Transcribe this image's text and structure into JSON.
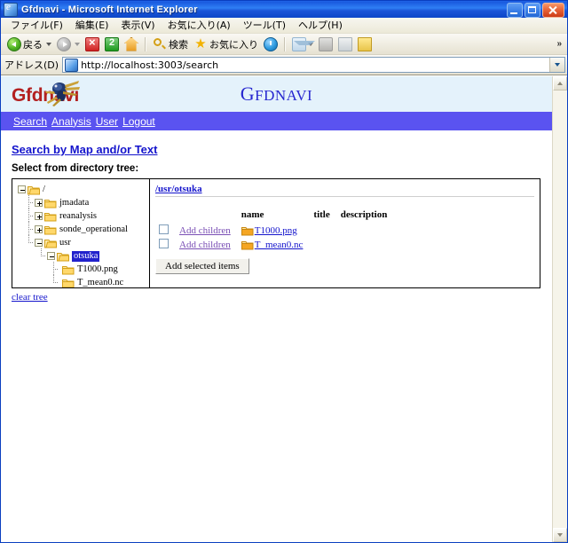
{
  "window": {
    "title": "Gfdnavi - Microsoft Internet Explorer",
    "minimize_label": "Minimize",
    "maximize_label": "Maximize",
    "close_label": "Close"
  },
  "menubar": {
    "items": [
      {
        "label": "ファイル(F)",
        "name": "menu-file"
      },
      {
        "label": "編集(E)",
        "name": "menu-edit"
      },
      {
        "label": "表示(V)",
        "name": "menu-view"
      },
      {
        "label": "お気に入り(A)",
        "name": "menu-favorites"
      },
      {
        "label": "ツール(T)",
        "name": "menu-tools"
      },
      {
        "label": "ヘルプ(H)",
        "name": "menu-help"
      }
    ]
  },
  "toolbar": {
    "back_label": "戻る",
    "search_label": "検索",
    "favorites_label": "お気に入り",
    "overflow_label": "»"
  },
  "address": {
    "label": "アドレス(D)",
    "url": "http://localhost:3003/search",
    "dropdown_label": "▼"
  },
  "banner": {
    "logo_text": "Gfdnavi",
    "title_big": "G",
    "title_small": "FDNAVI"
  },
  "nav": {
    "items": [
      {
        "label": "Search",
        "name": "nav-search"
      },
      {
        "label": "Analysis",
        "name": "nav-analysis"
      },
      {
        "label": "User",
        "name": "nav-user"
      },
      {
        "label": "Logout",
        "name": "nav-logout"
      }
    ]
  },
  "main": {
    "heading": "Search by Map and/or Text",
    "select_label": "Select from directory tree:",
    "clear_tree_label": "clear tree"
  },
  "tree": {
    "nodes": [
      {
        "label": "/",
        "depth": 0,
        "toggle": "minus",
        "selected": false,
        "open": true,
        "last": false
      },
      {
        "label": "jmadata",
        "depth": 1,
        "toggle": "plus",
        "selected": false,
        "open": false,
        "last": false
      },
      {
        "label": "reanalysis",
        "depth": 1,
        "toggle": "plus",
        "selected": false,
        "open": false,
        "last": false
      },
      {
        "label": "sonde_operational",
        "depth": 1,
        "toggle": "plus",
        "selected": false,
        "open": false,
        "last": false
      },
      {
        "label": "usr",
        "depth": 1,
        "toggle": "minus",
        "selected": false,
        "open": true,
        "last": true
      },
      {
        "label": "otsuka",
        "depth": 2,
        "toggle": "minus",
        "selected": true,
        "open": true,
        "last": true
      },
      {
        "label": "T1000.png",
        "depth": 3,
        "toggle": "none",
        "selected": false,
        "open": false,
        "last": false
      },
      {
        "label": "T_mean0.nc",
        "depth": 3,
        "toggle": "none",
        "selected": false,
        "open": false,
        "last": true
      }
    ]
  },
  "listing": {
    "path": "/usr/otsuka",
    "columns": [
      "name",
      "title",
      "description"
    ],
    "add_children_label": "Add children",
    "rows": [
      {
        "name": "T1000.png",
        "title": "",
        "description": "",
        "checked": false
      },
      {
        "name": "T_mean0.nc",
        "title": "",
        "description": "",
        "checked": false
      }
    ],
    "add_selected_label": "Add selected items"
  },
  "colors": {
    "nav_bar": "#5a53f0",
    "banner_bg": "#e4f2fb",
    "link": "#1414cc",
    "visited_link": "#7a4fb5",
    "logo": "#b32020",
    "selection": "#2222cc"
  }
}
